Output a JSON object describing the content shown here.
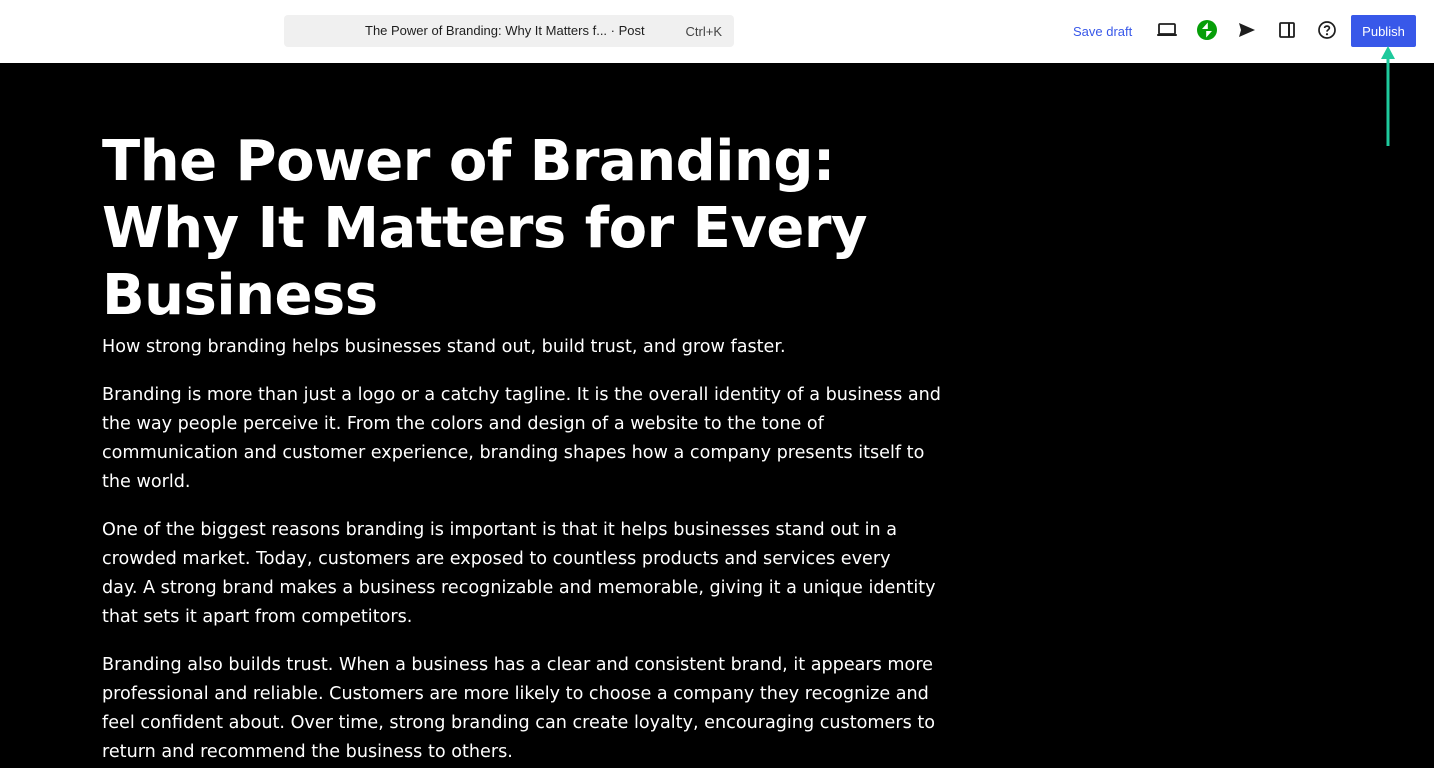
{
  "header": {
    "document_title": "The Power of Branding: Why It Matters f... · Post",
    "shortcut": "Ctrl+K",
    "save_draft_label": "Save draft",
    "publish_label": "Publish",
    "icons": [
      "preview-icon",
      "jetpack-icon",
      "send-icon",
      "sidebar-toggle-icon",
      "help-icon"
    ],
    "accent_color": "#3858e9",
    "jetpack_color": "#069e08",
    "annotation_arrow_color": "#1ec99c"
  },
  "post": {
    "title_lines": [
      "The Power of Branding:",
      "Why It Matters for Every",
      "Business"
    ],
    "subtitle": "How strong branding helps businesses stand out, build trust, and grow faster.",
    "paragraphs": [
      {
        "lines": [
          "Branding is more than just a logo or a catchy tagline. It is the overall identity of a business and",
          "the way people perceive it. From the colors and design of a website to the tone of",
          "communication and customer experience, branding shapes how a company presents itself to",
          "the world."
        ]
      },
      {
        "lines": [
          "One of the biggest reasons branding is important is that it helps businesses stand out in a",
          "crowded market. Today, customers are exposed to countless products and services every",
          "day. A strong brand makes a business recognizable and memorable, giving it a unique identity",
          "that sets it apart from competitors."
        ]
      },
      {
        "lines": [
          "Branding also builds trust. When a business has a clear and consistent brand, it appears more",
          "professional and reliable. Customers are more likely to choose a company they recognize and",
          "feel confident about. Over time, strong branding can create loyalty, encouraging customers to",
          "return and recommend the business to others."
        ]
      }
    ]
  }
}
